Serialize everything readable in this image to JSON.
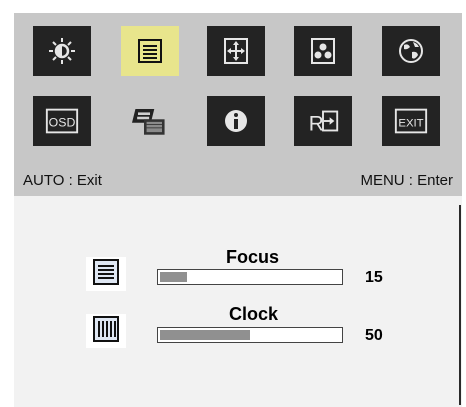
{
  "osd": {
    "icons": [
      {
        "name": "brightness-icon",
        "active": false
      },
      {
        "name": "picture-settings-icon",
        "active": true
      },
      {
        "name": "position-icon",
        "active": false
      },
      {
        "name": "color-icon",
        "active": false
      },
      {
        "name": "language-icon",
        "active": false
      },
      {
        "name": "osd-settings-icon",
        "active": false
      },
      {
        "name": "input-source-icon",
        "active": false
      },
      {
        "name": "information-icon",
        "active": false
      },
      {
        "name": "reset-icon",
        "active": false
      },
      {
        "name": "exit-icon",
        "active": false
      }
    ],
    "osd_icon_text": "OSD",
    "exit_icon_text": "EXIT",
    "hint_left": "AUTO : Exit",
    "hint_right": "MENU : Enter"
  },
  "params": [
    {
      "label": "Focus",
      "value": "15",
      "level": 0.15,
      "icon": "focus-icon"
    },
    {
      "label": "Clock",
      "value": "50",
      "level": 0.5,
      "icon": "clock-icon"
    }
  ],
  "colors": {
    "header_bg": "#c7c7c7",
    "panel_bg": "#f2f2f2",
    "tile_bg": "#232323",
    "active_tile_bg": "#e8e58c",
    "bar_fill": "#909090"
  }
}
